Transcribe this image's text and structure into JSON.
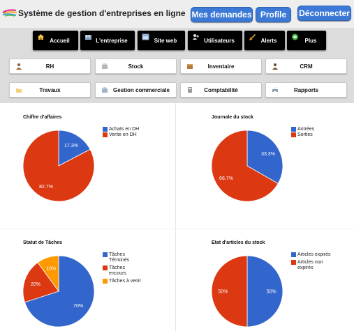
{
  "header": {
    "title": "Système de gestion d'entreprises en ligne",
    "buttons": {
      "requests": "Mes demandes",
      "profile": "Profile",
      "logout": "Déconnecter"
    }
  },
  "nav": [
    "Accueil",
    "L'entreprise",
    "Site web",
    "Utilisateurs",
    "Alerts",
    "Plus"
  ],
  "modules": [
    "RH",
    "Stock",
    "Inventaire",
    "CRM",
    "Travaux",
    "Gestion commerciale",
    "Comptabilité",
    "Rapports"
  ],
  "colors": {
    "blue": "#3366cc",
    "red": "#dc3912",
    "orange": "#ff9900",
    "button": "#3c79d6"
  },
  "chart_data": [
    {
      "type": "pie",
      "title": "Chiffre d'affaires",
      "labels": [
        "Achats en DH",
        "Vente en DH"
      ],
      "values": [
        17.3,
        82.7
      ],
      "value_labels": [
        "17.3%",
        "82.7%"
      ],
      "legend_position": "right"
    },
    {
      "type": "pie",
      "title": "Journale du stock",
      "labels": [
        "Antrées",
        "Sorties"
      ],
      "values": [
        33.3,
        66.7
      ],
      "value_labels": [
        "33.3%",
        "66.7%"
      ],
      "legend_position": "right"
    },
    {
      "type": "pie",
      "title": "Statut de Tâches",
      "labels": [
        "Tâches Términés",
        "Tâches encours",
        "Tâches à venir"
      ],
      "values": [
        70,
        20,
        10
      ],
      "value_labels": [
        "70%",
        "20%",
        "10%"
      ],
      "legend_position": "right"
    },
    {
      "type": "pie",
      "title": "Etat d'articles du stock",
      "labels": [
        "Articles expirés",
        "Articles non expirés"
      ],
      "values": [
        50,
        50
      ],
      "value_labels": [
        "50%",
        "50%"
      ],
      "legend_position": "right"
    }
  ]
}
